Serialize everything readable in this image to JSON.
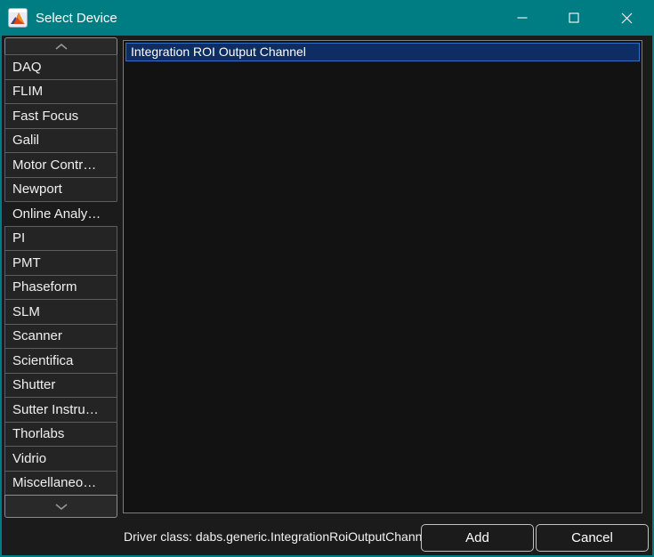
{
  "window": {
    "title": "Select Device",
    "colors": {
      "titlebar": "#007d82",
      "background": "#1b1b1b",
      "tab_fill": "#242424",
      "tab_border": "#5e5e5e",
      "list_background": "#121212",
      "list_border": "#7d7d7d",
      "selection_fill": "#0e2d62",
      "selection_border": "#2f6fc6",
      "button_border": "#c2c2c2",
      "text": "#f0f0f0"
    },
    "controls": {
      "minimize_icon": "minimize-icon",
      "maximize_icon": "maximize-icon",
      "close_icon": "close-icon"
    },
    "app_icon": "matlab-logo-icon"
  },
  "sidebar": {
    "scroll_up_icon": "chevron-up-icon",
    "scroll_down_icon": "chevron-down-icon",
    "tabs": [
      {
        "label": "DAQ",
        "selected": false
      },
      {
        "label": "FLIM",
        "selected": false
      },
      {
        "label": "Fast Focus",
        "selected": false
      },
      {
        "label": "Galil",
        "selected": false
      },
      {
        "label": "Motor Contr…",
        "selected": false
      },
      {
        "label": "Newport",
        "selected": false
      },
      {
        "label": "Online Analy…",
        "selected": true
      },
      {
        "label": "PI",
        "selected": false
      },
      {
        "label": "PMT",
        "selected": false
      },
      {
        "label": "Phaseform",
        "selected": false
      },
      {
        "label": "SLM",
        "selected": false
      },
      {
        "label": "Scanner",
        "selected": false
      },
      {
        "label": "Scientifica",
        "selected": false
      },
      {
        "label": "Shutter",
        "selected": false
      },
      {
        "label": "Sutter Instru…",
        "selected": false
      },
      {
        "label": "Thorlabs",
        "selected": false
      },
      {
        "label": "Vidrio",
        "selected": false
      },
      {
        "label": "Miscellaneo…",
        "selected": false
      }
    ]
  },
  "device_list": {
    "items": [
      {
        "label": "Integration ROI Output Channel",
        "selected": true
      }
    ]
  },
  "footer": {
    "driver_class_text": "Driver class: dabs.generic.IntegrationRoiOutputChannel",
    "add_label": "Add",
    "cancel_label": "Cancel"
  }
}
